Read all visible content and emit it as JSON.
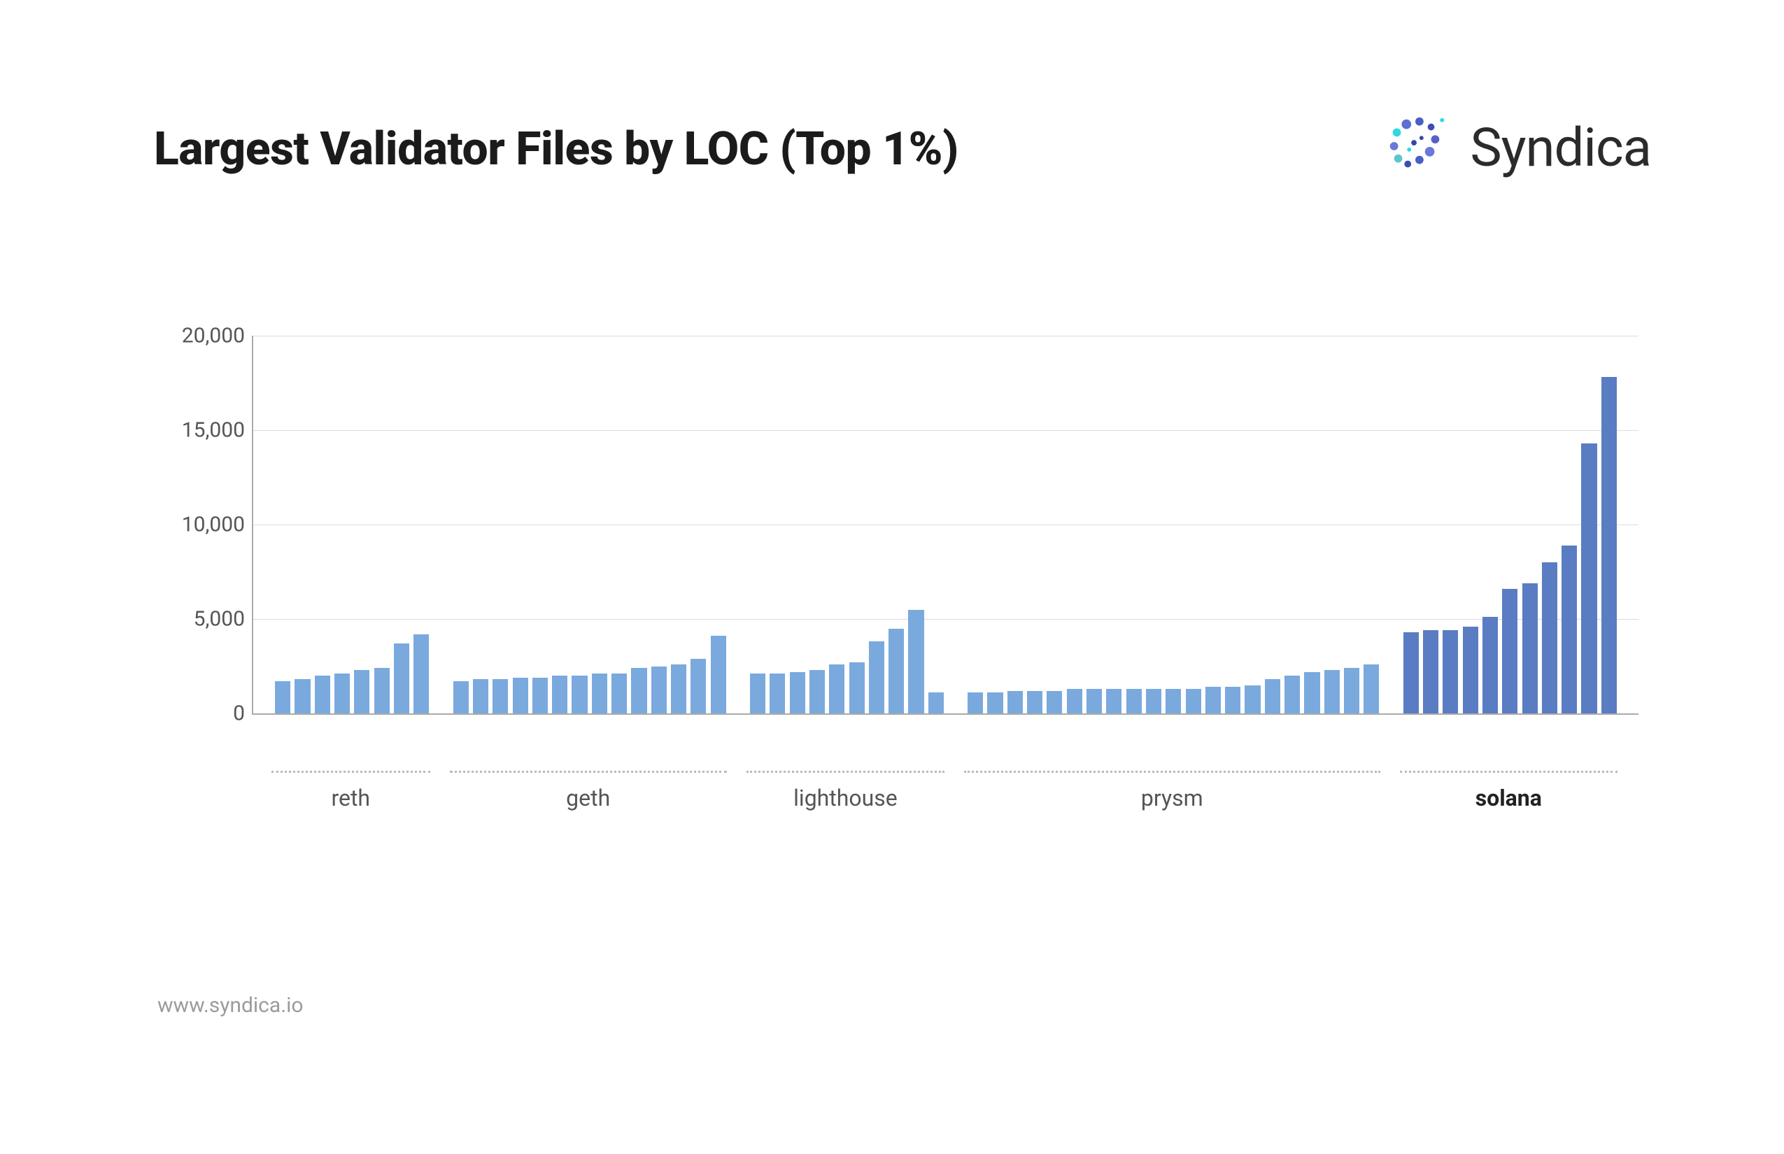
{
  "title": "Largest Validator Files by LOC (Top 1%)",
  "brand": "Syndica",
  "footer": "www.syndica.io",
  "colors": {
    "light": "#7aa9de",
    "dark": "#5a7cc2"
  },
  "chart_data": {
    "type": "bar",
    "ylabel": "",
    "xlabel": "",
    "title": "Largest Validator Files by LOC (Top 1%)",
    "ylim": [
      0,
      20000
    ],
    "yticks": [
      0,
      5000,
      10000,
      15000,
      20000
    ],
    "ytick_labels": [
      "0",
      "5,000",
      "10,000",
      "15,000",
      "20,000"
    ],
    "groups": [
      {
        "name": "reth",
        "highlight": false,
        "values": [
          1700,
          1800,
          2000,
          2100,
          2300,
          2400,
          3700,
          4200
        ]
      },
      {
        "name": "geth",
        "highlight": false,
        "values": [
          1700,
          1800,
          1800,
          1900,
          1900,
          2000,
          2000,
          2100,
          2100,
          2400,
          2500,
          2600,
          2900,
          4100
        ]
      },
      {
        "name": "lighthouse",
        "highlight": false,
        "values": [
          2100,
          2100,
          2200,
          2300,
          2600,
          2700,
          3800,
          4500,
          5500,
          1100
        ]
      },
      {
        "name": "prysm",
        "highlight": false,
        "values": [
          1100,
          1100,
          1200,
          1200,
          1200,
          1300,
          1300,
          1300,
          1300,
          1300,
          1300,
          1300,
          1400,
          1400,
          1500,
          1800,
          2000,
          2200,
          2300,
          2400,
          2600
        ]
      },
      {
        "name": "solana",
        "highlight": true,
        "values": [
          4300,
          4400,
          4400,
          4600,
          5100,
          6600,
          6900,
          8000,
          8900,
          14300,
          17800
        ]
      }
    ]
  }
}
